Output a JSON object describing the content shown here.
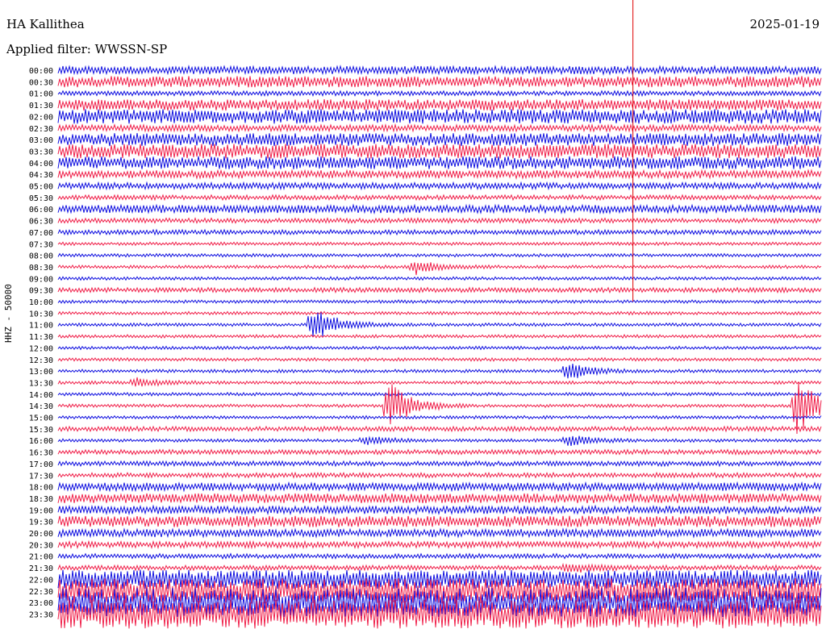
{
  "header": {
    "station": "HA Kallithea",
    "date": "2025-01-19",
    "filter_label": "Applied filter: WWSSN-SP"
  },
  "axis_label": "HHZ - 50000",
  "colors": {
    "a": "#1010e0",
    "b": "#f0204a",
    "marker": "#e00000"
  },
  "chart_data": {
    "type": "line",
    "ylabel": "HHZ - 50000",
    "row_labels": [
      "00:00",
      "00:30",
      "01:00",
      "01:30",
      "02:00",
      "02:30",
      "03:00",
      "03:30",
      "04:00",
      "04:30",
      "05:00",
      "05:30",
      "06:00",
      "06:30",
      "07:00",
      "07:30",
      "08:00",
      "08:30",
      "09:00",
      "09:30",
      "10:00",
      "10:30",
      "11:00",
      "11:30",
      "12:00",
      "12:30",
      "13:00",
      "13:30",
      "14:00",
      "14:30",
      "15:00",
      "15:30",
      "16:00",
      "16:30",
      "17:00",
      "17:30",
      "18:00",
      "18:30",
      "19:00",
      "19:30",
      "20:00",
      "20:30",
      "21:00",
      "21:30",
      "22:00",
      "22:30",
      "23:00",
      "23:30"
    ],
    "row_minutes": 30,
    "series": [
      {
        "values": [
          5,
          7,
          3,
          7,
          9,
          4,
          8,
          9,
          8,
          5,
          4,
          3,
          5,
          3,
          3,
          2,
          2,
          2,
          2,
          3,
          2,
          2,
          2,
          2,
          2,
          2,
          2,
          2,
          2,
          2,
          2,
          3,
          2,
          3,
          3,
          3,
          5,
          6,
          5,
          7,
          5,
          4,
          3,
          3,
          12,
          16,
          18,
          18
        ]
      }
    ],
    "events": [
      {
        "row": "08:30",
        "minute": 14,
        "amplitude": 10
      },
      {
        "row": "11:00",
        "minute": 10,
        "amplitude": 22
      },
      {
        "row": "13:00",
        "minute": 20,
        "amplitude": 12
      },
      {
        "row": "13:30",
        "minute": 3,
        "amplitude": 6
      },
      {
        "row": "14:30",
        "minute": 13,
        "amplitude": 30
      },
      {
        "row": "14:30",
        "minute": 29,
        "amplitude": 40
      },
      {
        "row": "16:00",
        "minute": 12,
        "amplitude": 6
      },
      {
        "row": "16:00",
        "minute": 20,
        "amplitude": 8
      },
      {
        "row": "21:30",
        "minute": 20,
        "amplitude": 6
      }
    ],
    "marker": {
      "minute": 22.6,
      "from_row": "00:00",
      "to_row": "10:00"
    }
  }
}
